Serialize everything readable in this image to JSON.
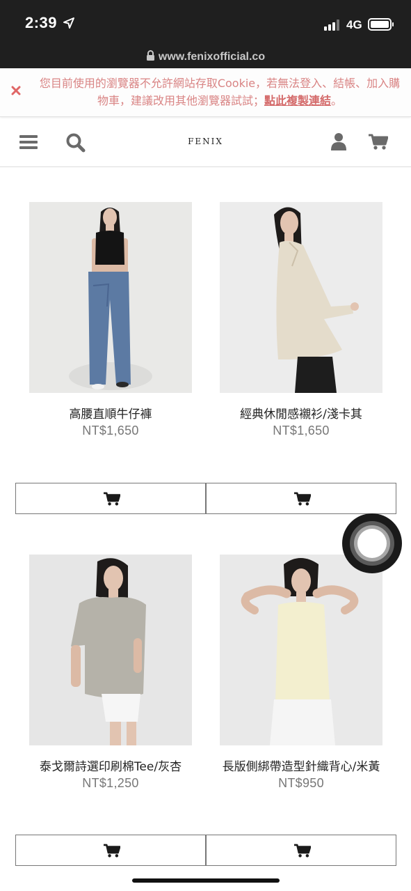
{
  "status_bar": {
    "time": "2:39",
    "network": "4G",
    "icons": [
      "location-arrow-icon",
      "signal-bars-icon",
      "battery-icon"
    ]
  },
  "browser": {
    "url": "www.fenixofficial.co",
    "icons": [
      "lock-icon"
    ]
  },
  "cookie_banner": {
    "message": "您目前使用的瀏覽器不允許網站存取Cookie，若無法登入、結帳、加入購物車，建議改用其他瀏覽器試試；",
    "link": "點此複製連結",
    "suffix": "。",
    "colors": {
      "text": "#d98484",
      "close": "#e06666"
    }
  },
  "header": {
    "brand": "FENIX",
    "icons": [
      "menu-icon",
      "search-icon",
      "user-icon",
      "cart-icon"
    ]
  },
  "products": [
    {
      "name": "高腰直順牛仔褲",
      "price": "NT$1,650"
    },
    {
      "name": "經典休閒感襯衫/淺卡其",
      "price": "NT$1,650"
    },
    {
      "name": "泰戈爾詩選印刷棉Tee/灰杏",
      "price": "NT$1,250"
    },
    {
      "name": "長版側綁帶造型針織背心/米黃",
      "price": "NT$950"
    }
  ]
}
